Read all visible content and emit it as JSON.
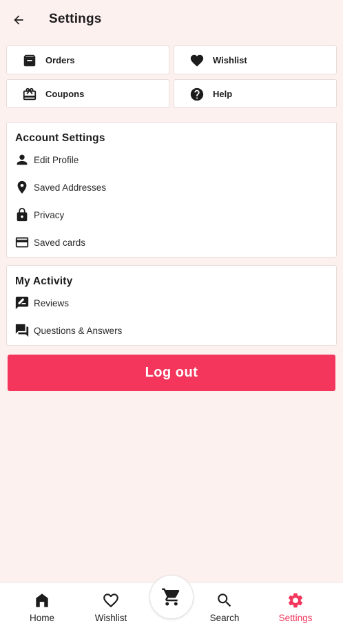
{
  "header": {
    "title": "Settings",
    "back_icon": "arrow-back-icon"
  },
  "quick_links": [
    {
      "label": "Orders",
      "icon": "archive-icon"
    },
    {
      "label": "Wishlist",
      "icon": "heart-icon"
    },
    {
      "label": "Coupons",
      "icon": "gift-card-icon"
    },
    {
      "label": "Help",
      "icon": "help-circle-icon"
    }
  ],
  "account_settings": {
    "title": "Account Settings",
    "items": [
      {
        "label": "Edit Profile",
        "icon": "person-icon"
      },
      {
        "label": "Saved Addresses",
        "icon": "location-pin-icon"
      },
      {
        "label": "Privacy",
        "icon": "lock-icon"
      },
      {
        "label": "Saved cards",
        "icon": "credit-card-icon"
      }
    ]
  },
  "my_activity": {
    "title": "My Activity",
    "items": [
      {
        "label": "Reviews",
        "icon": "rate-review-icon"
      },
      {
        "label": "Questions & Answers",
        "icon": "forum-icon"
      }
    ]
  },
  "logout_label": "Log out",
  "bottom_nav": {
    "items": [
      {
        "label": "Home",
        "icon": "home-icon",
        "active": false
      },
      {
        "label": "Wishlist",
        "icon": "heart-outline-icon",
        "active": false
      },
      {
        "label": "Search",
        "icon": "search-icon",
        "active": false
      },
      {
        "label": "Settings",
        "icon": "gear-icon",
        "active": true
      }
    ],
    "cart_icon": "cart-icon"
  },
  "colors": {
    "accent": "#f5365c",
    "background": "#fdf1ef",
    "card": "#ffffff",
    "icon": "#1c1c1c"
  }
}
